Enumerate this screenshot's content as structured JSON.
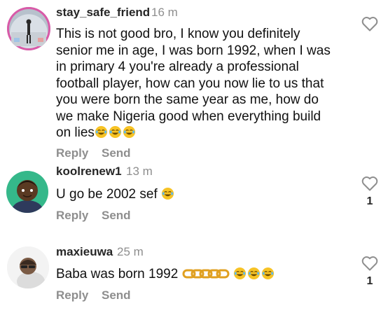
{
  "comments": [
    {
      "username": "stay_safe_friend",
      "time": "16 m",
      "text": "This is not good bro, I know you definitely senior me in age, I was born 1992, when I was in primary 4 you're already a professional football player, how can you now lie to us that you were born the same year as me, how do we make Nigeria good when everything build on lies",
      "emojis": [
        "laughing-tears-emoji",
        "laughing-tears-emoji",
        "laughing-tears-emoji"
      ],
      "reply_label": "Reply",
      "send_label": "Send",
      "likes": ""
    },
    {
      "username": "koolrenew1",
      "time": "13 m",
      "text": "U go be 2002 sef",
      "emojis": [
        "laughing-tears-emoji"
      ],
      "reply_label": "Reply",
      "send_label": "Send",
      "likes": "1"
    },
    {
      "username": "maxieuwa",
      "time": "25 m",
      "text": "Baba was born 1992",
      "emojis": [
        "chain-emoji",
        "laughing-tears-emoji",
        "laughing-tears-emoji",
        "laughing-tears-emoji"
      ],
      "reply_label": "Reply",
      "send_label": "Send",
      "likes": "1"
    }
  ],
  "icons": {
    "like": "heart-outline-icon"
  },
  "colors": {
    "muted": "#8e8e8e",
    "text": "#111111",
    "avatar_ring": "#d95aa8",
    "emoji": "#f7c325"
  }
}
